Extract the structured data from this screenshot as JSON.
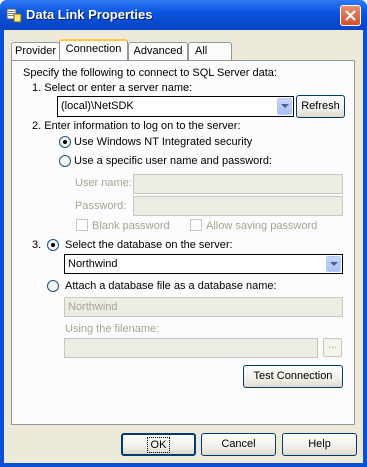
{
  "window": {
    "title": "Data Link Properties",
    "app_icon": "data-link-icon",
    "close_icon": "close-icon"
  },
  "tabs": [
    {
      "label": "Provider",
      "active": false
    },
    {
      "label": "Connection",
      "active": true
    },
    {
      "label": "Advanced",
      "active": false
    },
    {
      "label": "All",
      "active": false
    }
  ],
  "connection": {
    "intro": "Specify the following to connect to SQL Server data:",
    "step1_label": "1. Select or enter a server name:",
    "server_name": "(local)\\NetSDK",
    "refresh_button": "Refresh",
    "step2_label": "2. Enter information to log on to the server:",
    "nt_security_label": "Use Windows NT Integrated security",
    "nt_security_selected": true,
    "specific_user_label": "Use a specific user name and password:",
    "specific_user_selected": false,
    "user_name_label": "User name:",
    "user_name_value": "",
    "password_label": "Password:",
    "password_value": "",
    "blank_password_label": "Blank password",
    "allow_saving_label": "Allow saving password",
    "step3_label": "3.",
    "select_db_label": "Select the database on the server:",
    "select_db_selected": true,
    "database_name": "Northwind",
    "attach_db_label": "Attach a database file as a database name:",
    "attach_db_selected": false,
    "attach_db_name": "Northwind",
    "using_filename_label": "Using the filename:",
    "filename_value": "",
    "browse_button": "...",
    "test_connection_button": "Test Connection"
  },
  "footer": {
    "ok_button": "OK",
    "cancel_button": "Cancel",
    "help_button": "Help"
  },
  "colors": {
    "title_bar": "#0b56e0",
    "dialog_background": "#ece9d8",
    "close_button": "#d3502b",
    "radio_selected": "#21a121",
    "tab_highlight": "#ffc83c"
  }
}
